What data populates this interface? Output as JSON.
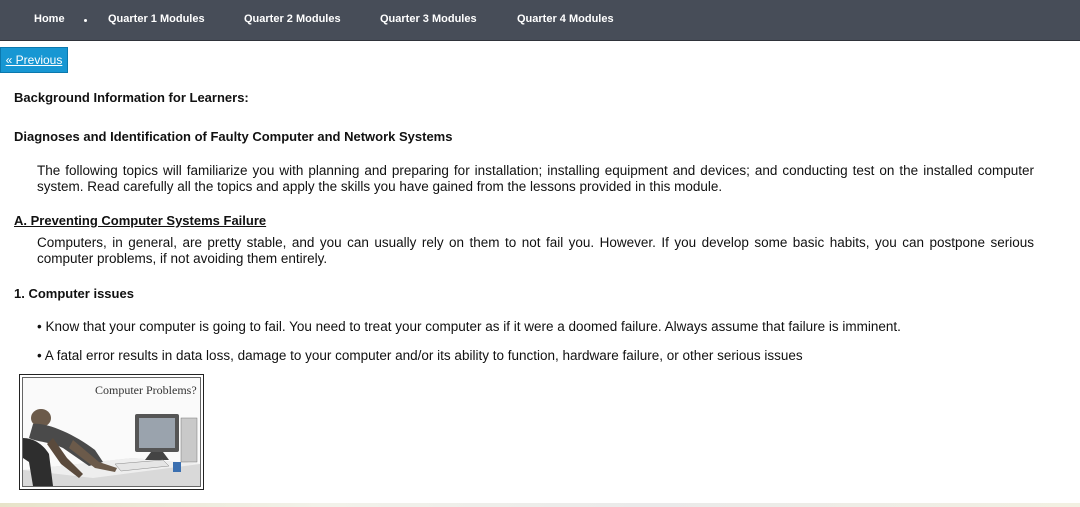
{
  "nav": {
    "items": [
      {
        "label": "Home"
      },
      {
        "label": "Quarter 1 Modules"
      },
      {
        "label": "Quarter 2 Modules"
      },
      {
        "label": "Quarter 3 Modules"
      },
      {
        "label": "Quarter 4 Modules"
      }
    ]
  },
  "previous_label": "« Previous",
  "content": {
    "heading_background": "Background Information for Learners:",
    "heading_diagnoses": "Diagnoses and Identification of Faulty Computer and Network Systems",
    "intro_paragraph": "The following topics will familiarize you with planning and preparing for installation; installing equipment and devices; and conducting test on the installed computer system. Read carefully all the topics and apply the skills you have gained from the lessons provided in this module.",
    "section_a_title": "A. Preventing Computer Systems Failure",
    "section_a_paragraph": "Computers, in general, are pretty stable, and you can usually rely on them to not fail you. However. If you develop some basic habits, you can postpone serious computer problems, if not avoiding them entirely.",
    "issues_heading": "1. Computer issues",
    "bullets": [
      "• Know that your computer is going to fail. You need to treat your computer as if it were a doomed failure. Always assume that failure is imminent.",
      "• A fatal error results in data loss, damage to your computer and/or its ability to function, hardware failure, or other serious issues"
    ],
    "image_caption": "Computer Problems?"
  },
  "colors": {
    "nav_bg": "#474d58",
    "button_bg": "#1797d3"
  }
}
